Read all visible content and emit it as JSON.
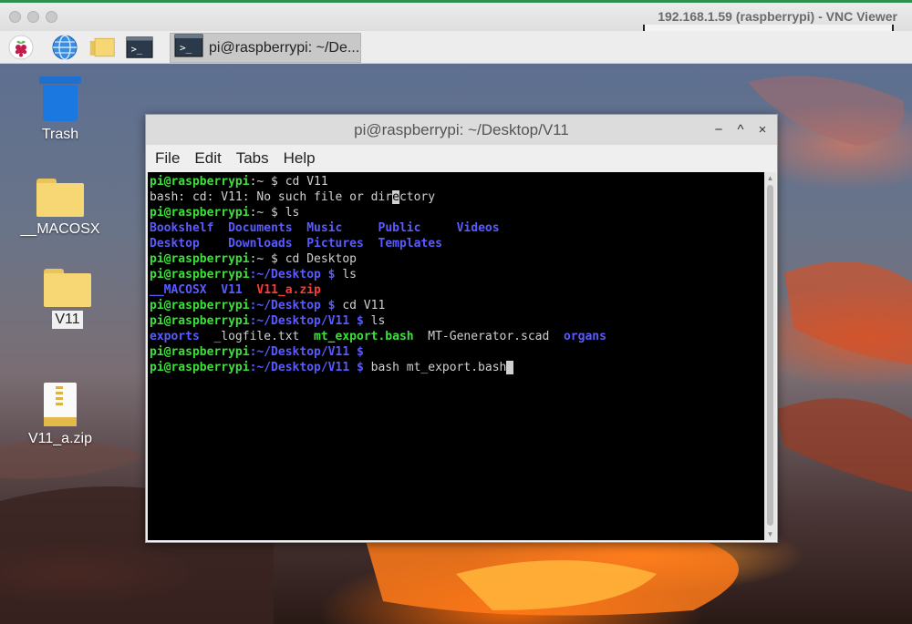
{
  "vnc": {
    "window_title": "192.168.1.59 (raspberrypi) - VNC Viewer"
  },
  "taskbar": {
    "icons": [
      "raspberry-menu-icon",
      "web-browser-icon",
      "file-manager-icon",
      "terminal-icon"
    ],
    "active_task_label": "pi@raspberrypi: ~/De..."
  },
  "desktop": {
    "icons": [
      {
        "label": "Trash",
        "type": "trash"
      },
      {
        "label": "__MACOSX",
        "type": "folder"
      },
      {
        "label": "V11",
        "type": "folder",
        "selected": true
      },
      {
        "label": "V11_a.zip",
        "type": "zip"
      }
    ]
  },
  "terminal": {
    "title": "pi@raspberrypi: ~/Desktop/V11",
    "window_controls": [
      "−",
      "^",
      "×"
    ],
    "menu": [
      "File",
      "Edit",
      "Tabs",
      "Help"
    ],
    "lines": [
      [
        {
          "t": "pi@raspberrypi",
          "c": "g"
        },
        {
          "t": ":~ $ ",
          "c": "n"
        },
        {
          "t": "cd V11",
          "c": "n"
        }
      ],
      [
        {
          "t": "bash: cd: V11: No such file or dir",
          "c": "n"
        },
        {
          "t": "e",
          "c": "inv"
        },
        {
          "t": "ctory",
          "c": "n"
        }
      ],
      [
        {
          "t": "pi@raspberrypi",
          "c": "g"
        },
        {
          "t": ":~ $ ",
          "c": "n"
        },
        {
          "t": "ls",
          "c": "n"
        }
      ],
      [
        {
          "t": "Bookshelf",
          "c": "b"
        },
        {
          "t": "  ",
          "c": "n"
        },
        {
          "t": "Documents",
          "c": "b"
        },
        {
          "t": "  ",
          "c": "n"
        },
        {
          "t": "Music",
          "c": "b"
        },
        {
          "t": "     ",
          "c": "n"
        },
        {
          "t": "Public",
          "c": "b"
        },
        {
          "t": "     ",
          "c": "n"
        },
        {
          "t": "Videos",
          "c": "b"
        }
      ],
      [
        {
          "t": "Desktop",
          "c": "b"
        },
        {
          "t": "    ",
          "c": "n"
        },
        {
          "t": "Downloads",
          "c": "b"
        },
        {
          "t": "  ",
          "c": "n"
        },
        {
          "t": "Pictures",
          "c": "b"
        },
        {
          "t": "  ",
          "c": "n"
        },
        {
          "t": "Templates",
          "c": "b"
        }
      ],
      [
        {
          "t": "pi@raspberrypi",
          "c": "g"
        },
        {
          "t": ":~ $ ",
          "c": "n"
        },
        {
          "t": "cd Desktop",
          "c": "n"
        }
      ],
      [
        {
          "t": "pi@raspberrypi",
          "c": "g"
        },
        {
          "t": ":~/Desktop $ ",
          "c": "bn"
        },
        {
          "t": "ls",
          "c": "n"
        }
      ],
      [
        {
          "t": "__MACOSX",
          "c": "b"
        },
        {
          "t": "  ",
          "c": "n"
        },
        {
          "t": "V11",
          "c": "b"
        },
        {
          "t": "  ",
          "c": "n"
        },
        {
          "t": "V11_a.zip",
          "c": "r"
        }
      ],
      [
        {
          "t": "pi@raspberrypi",
          "c": "g"
        },
        {
          "t": ":~/Desktop $ ",
          "c": "bn"
        },
        {
          "t": "cd V11",
          "c": "n"
        }
      ],
      [
        {
          "t": "pi@raspberrypi",
          "c": "g"
        },
        {
          "t": ":~/Desktop/V11 $ ",
          "c": "bn"
        },
        {
          "t": "ls",
          "c": "n"
        }
      ],
      [
        {
          "t": "exports",
          "c": "b"
        },
        {
          "t": "  ",
          "c": "n"
        },
        {
          "t": "_logfile.txt",
          "c": "n"
        },
        {
          "t": "  ",
          "c": "n"
        },
        {
          "t": "mt_export.bash",
          "c": "gb"
        },
        {
          "t": "  ",
          "c": "n"
        },
        {
          "t": "MT-Generator.scad",
          "c": "n"
        },
        {
          "t": "  ",
          "c": "n"
        },
        {
          "t": "organs",
          "c": "b"
        }
      ],
      [
        {
          "t": "pi@raspberrypi",
          "c": "g"
        },
        {
          "t": ":~/Desktop/V11 $ ",
          "c": "bn"
        }
      ],
      [
        {
          "t": "pi@raspberrypi",
          "c": "g"
        },
        {
          "t": ":~/Desktop/V11 $ ",
          "c": "bn"
        },
        {
          "t": "bash mt_export.bash",
          "c": "n"
        },
        {
          "t": " ",
          "c": "cursor"
        }
      ]
    ]
  },
  "colors": {
    "prompt_user": "#3ce03c",
    "directory": "#5a5aff",
    "archive": "#ff3a3a",
    "executable": "#3ce03c",
    "terminal_bg": "#000000"
  }
}
